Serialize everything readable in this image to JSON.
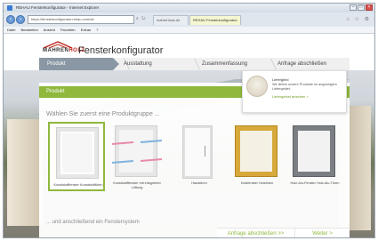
{
  "browser": {
    "window_title": "REHAU Fensterkonfigurator - Internet Explorer",
    "address": "https://fensterkonfigurator.rehau.com/de",
    "tabs": [
      {
        "label": "mahrenholz.de"
      },
      {
        "label": "REHAU Fensterkonfigurator"
      }
    ],
    "menu": [
      "Datei",
      "Bearbeiten",
      "Ansicht",
      "Favoriten",
      "Extras",
      "?"
    ]
  },
  "header": {
    "logo_text_prefix": "MAHREN",
    "logo_text_suffix": "HOLZ",
    "page_title": "Fensterkonfigurator"
  },
  "steps": [
    {
      "label": "Produkt",
      "active": true
    },
    {
      "label": "Ausstattung",
      "active": false
    },
    {
      "label": "Zusammenfassung",
      "active": false
    },
    {
      "label": "Anfrage abschließen",
      "active": false
    }
  ],
  "section_bar": {
    "label": "Produkt"
  },
  "info_box": {
    "title": "Lieferglied",
    "text": "Wir liefern unsere Produkte im angezeigten Liefergebiet.",
    "link": "Liefergebiet ansehen >"
  },
  "product_heading": "Wählen Sie zuerst eine Produktgruppe ...",
  "products": [
    {
      "caption": "Kunststofffenster Kunststofftüren",
      "selected": true
    },
    {
      "caption": "Kunststofffenster mit integrierter Lüftung",
      "selected": false
    },
    {
      "caption": "Haustüren",
      "selected": false
    },
    {
      "caption": "Holzfenster Holztüren",
      "selected": false
    },
    {
      "caption": "Holz-Alu-Fenster Holz-Alu-Türen",
      "selected": false
    }
  ],
  "system_heading": "... und anschließend ein Fenstersystem",
  "actions": {
    "request_label": "Anfrage abschließen >>",
    "next_label": "Weiter >"
  },
  "colors": {
    "accent_green": "#8fb83d",
    "step_active": "#8a97a5",
    "logo_red": "#b8251b"
  }
}
